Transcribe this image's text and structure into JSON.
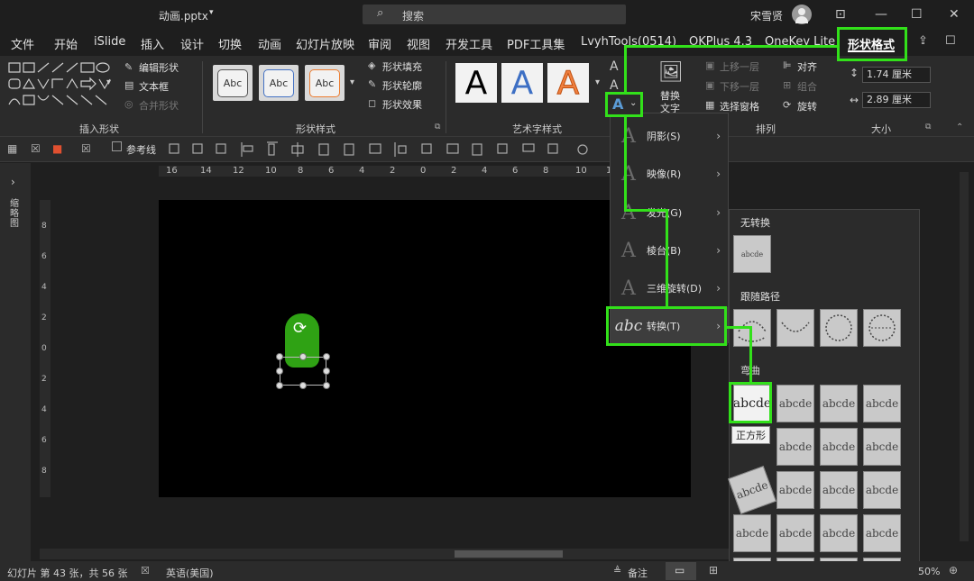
{
  "titlebar": {
    "filename": "动画.pptx",
    "search_placeholder": "搜索",
    "user": "宋雪贤"
  },
  "tabs": [
    "文件",
    "开始",
    "iSlide",
    "插入",
    "设计",
    "切换",
    "动画",
    "幻灯片放映",
    "审阅",
    "视图",
    "开发工具",
    "PDF工具集",
    "LvyhTools(0514)",
    "OKPlus 4.3",
    "OneKey Lite",
    "形状格式"
  ],
  "ribbon": {
    "insert_shapes": {
      "edit_shape": "编辑形状",
      "textbox": "文本框",
      "merge_shapes": "合并形状",
      "label": "插入形状"
    },
    "shape_styles": {
      "preset": "Abc",
      "fill": "形状填充",
      "outline": "形状轮廓",
      "effects": "形状效果",
      "label": "形状样式"
    },
    "wordart": {
      "preset_letter": "A",
      "label": "艺术字样式"
    },
    "alt_text": {
      "line1": "替换",
      "line2": "文字"
    },
    "arrange": {
      "bring_forward": "上移一层",
      "send_backward": "下移一层",
      "selection_pane": "选择窗格",
      "align": "对齐",
      "group": "组合",
      "rotate": "旋转",
      "label": "排列"
    },
    "size": {
      "height": "1.74 厘米",
      "width": "2.89 厘米",
      "label": "大小"
    }
  },
  "qat": {
    "guides": "参考线"
  },
  "ruler_h": [
    "16",
    "14",
    "12",
    "10",
    "8",
    "6",
    "4",
    "2",
    "0",
    "2",
    "4",
    "6",
    "8",
    "10",
    "12"
  ],
  "ruler_v": [
    "8",
    "6",
    "4",
    "2",
    "0",
    "2",
    "4",
    "6",
    "8"
  ],
  "side_panel": {
    "label": "缩略图"
  },
  "text_effects_menu": {
    "items": [
      {
        "label": "阴影(S)"
      },
      {
        "label": "映像(R)"
      },
      {
        "label": "发光(G)"
      },
      {
        "label": "棱台(B)"
      },
      {
        "label": "三维旋转(D)"
      },
      {
        "label": "转换(T)",
        "glyph": "abc"
      }
    ]
  },
  "transform_gallery": {
    "no_transform": "无转换",
    "follow_path": "跟随路径",
    "warp": "弯曲",
    "sample": "abcde",
    "sample_small": "abcde",
    "tooltip": "正方形"
  },
  "statusbar": {
    "slide_info": "幻灯片 第 43 张，共 56 张",
    "language": "英语(美国)",
    "notes": "备注",
    "zoom": "50%"
  },
  "colors": {
    "highlight": "#32e01a",
    "shape_fill": "#2fa214",
    "background": "#1f1f1f"
  }
}
